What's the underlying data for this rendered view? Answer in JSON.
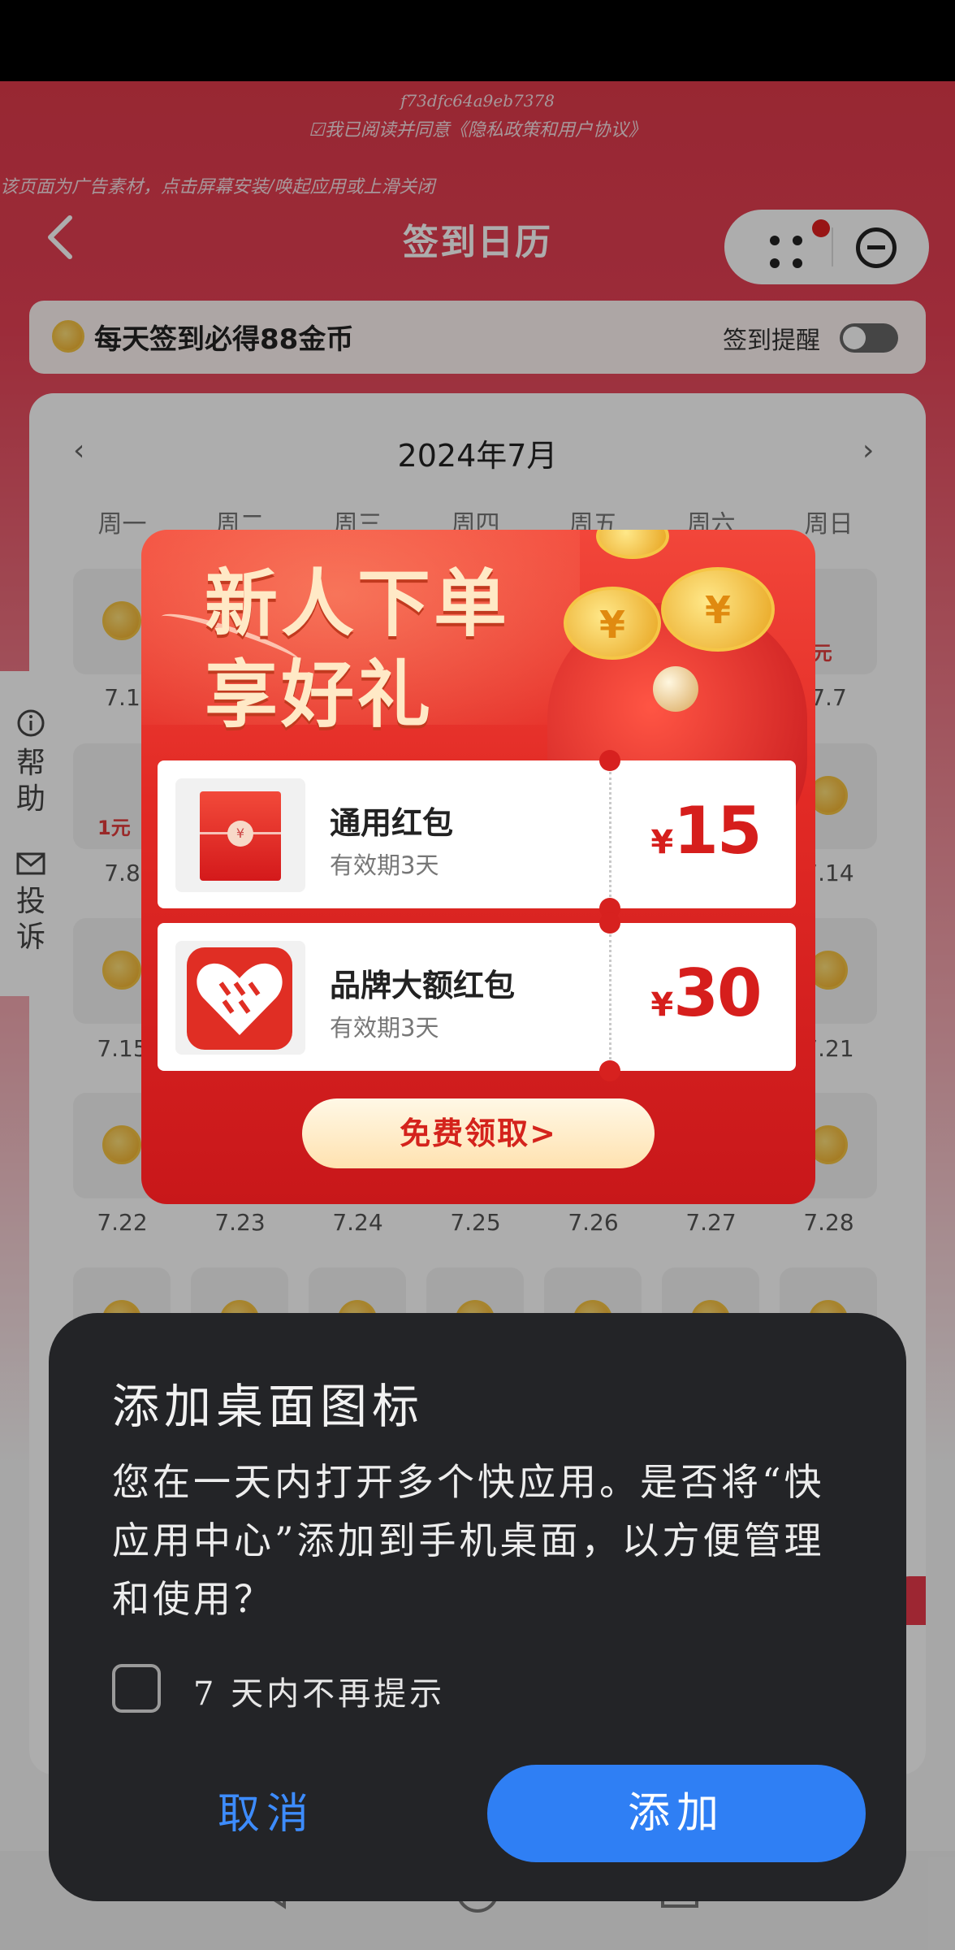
{
  "page": {
    "watermark_id": "f73dfc64a9eb7378",
    "agreement_text": "☑我已阅读并同意《隐私政策和用户协议》",
    "ad_notice": "该页面为广告素材，点击屏幕安装/唤起应用或上滑关闭",
    "title": "签到日历"
  },
  "banner": {
    "text": "每天签到必得88金币",
    "reminder_label": "签到提醒",
    "reminder_on": false
  },
  "calendar": {
    "month": "2024年7月",
    "weekdays": [
      "周一",
      "周二",
      "周三",
      "周四",
      "周五",
      "周六",
      "周日"
    ],
    "visible_dates": {
      "row1_first": "7.1",
      "row1_last": "7.7",
      "row1_last_badge": "8元",
      "row2_first": "7.8",
      "row2_first_badge": "1元",
      "row2_last": "7.14",
      "row3_first": "7.15",
      "row3_last": "7.21",
      "row4": [
        "7.22",
        "7.23",
        "7.24",
        "7.25",
        "7.26",
        "7.27",
        "7.28"
      ]
    }
  },
  "side_tab": {
    "help_label": "帮助",
    "complaint_label": "投诉"
  },
  "promo": {
    "headline_line1": "新人下单",
    "headline_line2": "享好礼",
    "coupons": [
      {
        "title": "通用红包",
        "validity": "有效期3天",
        "currency": "¥",
        "amount": "15"
      },
      {
        "title": "品牌大额红包",
        "validity": "有效期3天",
        "currency": "¥",
        "amount": "30"
      }
    ],
    "claim_button": "免费领取>"
  },
  "dialog": {
    "title": "添加桌面图标",
    "body": "您在一天内打开多个快应用。是否将“快应用中心”添加到手机桌面，以方便管理和使用？",
    "checkbox_label": "7 天内不再提示",
    "checkbox_checked": false,
    "cancel_label": "取消",
    "add_label": "添加"
  },
  "colors": {
    "page_red": "#e03a4b",
    "dialog_bg": "#232427",
    "add_button": "#2f7ff4",
    "cancel_text": "#3d8cff"
  }
}
